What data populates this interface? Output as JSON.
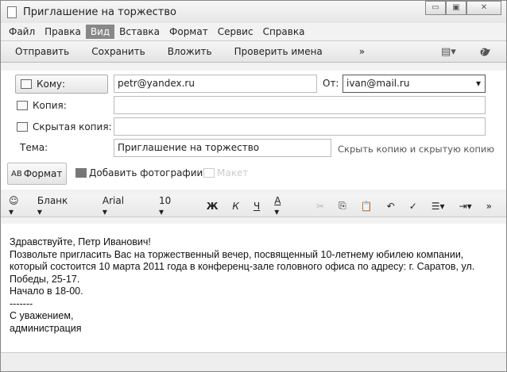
{
  "window": {
    "title": "Приглашение на торжество",
    "min": "▭",
    "max": "▣",
    "close": "✕"
  },
  "menu": [
    "Файл",
    "Правка",
    "Вид",
    "Вставка",
    "Формат",
    "Сервис",
    "Справка"
  ],
  "toolbar": {
    "send": "Отправить",
    "save": "Сохранить",
    "attach": "Вложить",
    "check": "Проверить имена",
    "more": "»",
    "help": "?"
  },
  "fields": {
    "to_label": "Кому:",
    "to_value": "petr@yandex.ru",
    "from_label": "От:",
    "from_value": "ivan@mail.ru",
    "cc_label": "Копия:",
    "bcc_label": "Скрытая копия:",
    "subject_label": "Тема:",
    "subject_value": "Приглашение на торжество",
    "hide_link": "Скрыть копию и скрытую копию"
  },
  "actions": {
    "format": "Формат",
    "photos": "Добавить фотографии",
    "layout": "Макет"
  },
  "format_bar": {
    "stationery": "Бланк",
    "font": "Arial",
    "size": "10",
    "bold": "Ж",
    "italic": "К",
    "underline": "Ч",
    "color": "A",
    "more": "»"
  },
  "body": [
    "Здравствуйте, Петр Иванович!",
    "Позвольте пригласить Вас на торжественный вечер, посвященный 10-летнему юбилею компании, который состоится 10 марта 2011 года в конференц-зале головного офиса по адресу: г. Саратов, ул. Победы, 25-17.",
    "Начало в 18-00.",
    "-------",
    "С уважением,",
    "администрация"
  ]
}
